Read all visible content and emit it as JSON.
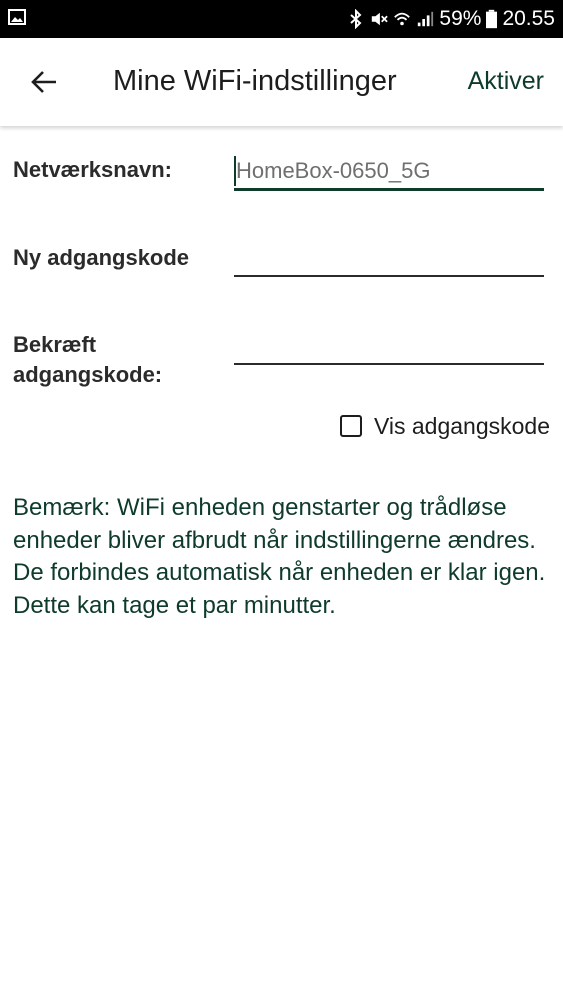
{
  "status_bar": {
    "battery_text": "59%",
    "time": "20.55",
    "icons": [
      "gallery-icon",
      "bluetooth-icon",
      "mute-icon",
      "wifi-icon",
      "signal-icon",
      "battery-icon"
    ]
  },
  "app_bar": {
    "back_icon": "arrow-left-icon",
    "title": "Mine WiFi-indstillinger",
    "action_label": "Aktiver"
  },
  "form": {
    "network_name": {
      "label": "Netværksnavn:",
      "value": "HomeBox-0650_5G"
    },
    "new_password": {
      "label": "Ny adgangskode",
      "value": ""
    },
    "confirm_password": {
      "label_line1": "Bekræft",
      "label_line2": "adgangskode:",
      "value": ""
    },
    "show_password": {
      "label": "Vis adgangskode",
      "checked": false
    }
  },
  "note": {
    "text": "Bemærk: WiFi enheden genstarter og trådløse enheder bliver afbrudt når indstillingerne ændres. De forbindes automatisk når enheden er klar igen. Dette kan tage et par minutter."
  },
  "colors": {
    "accent": "#0e3b2a",
    "status_bar": "#000000",
    "background": "#ffffff"
  }
}
